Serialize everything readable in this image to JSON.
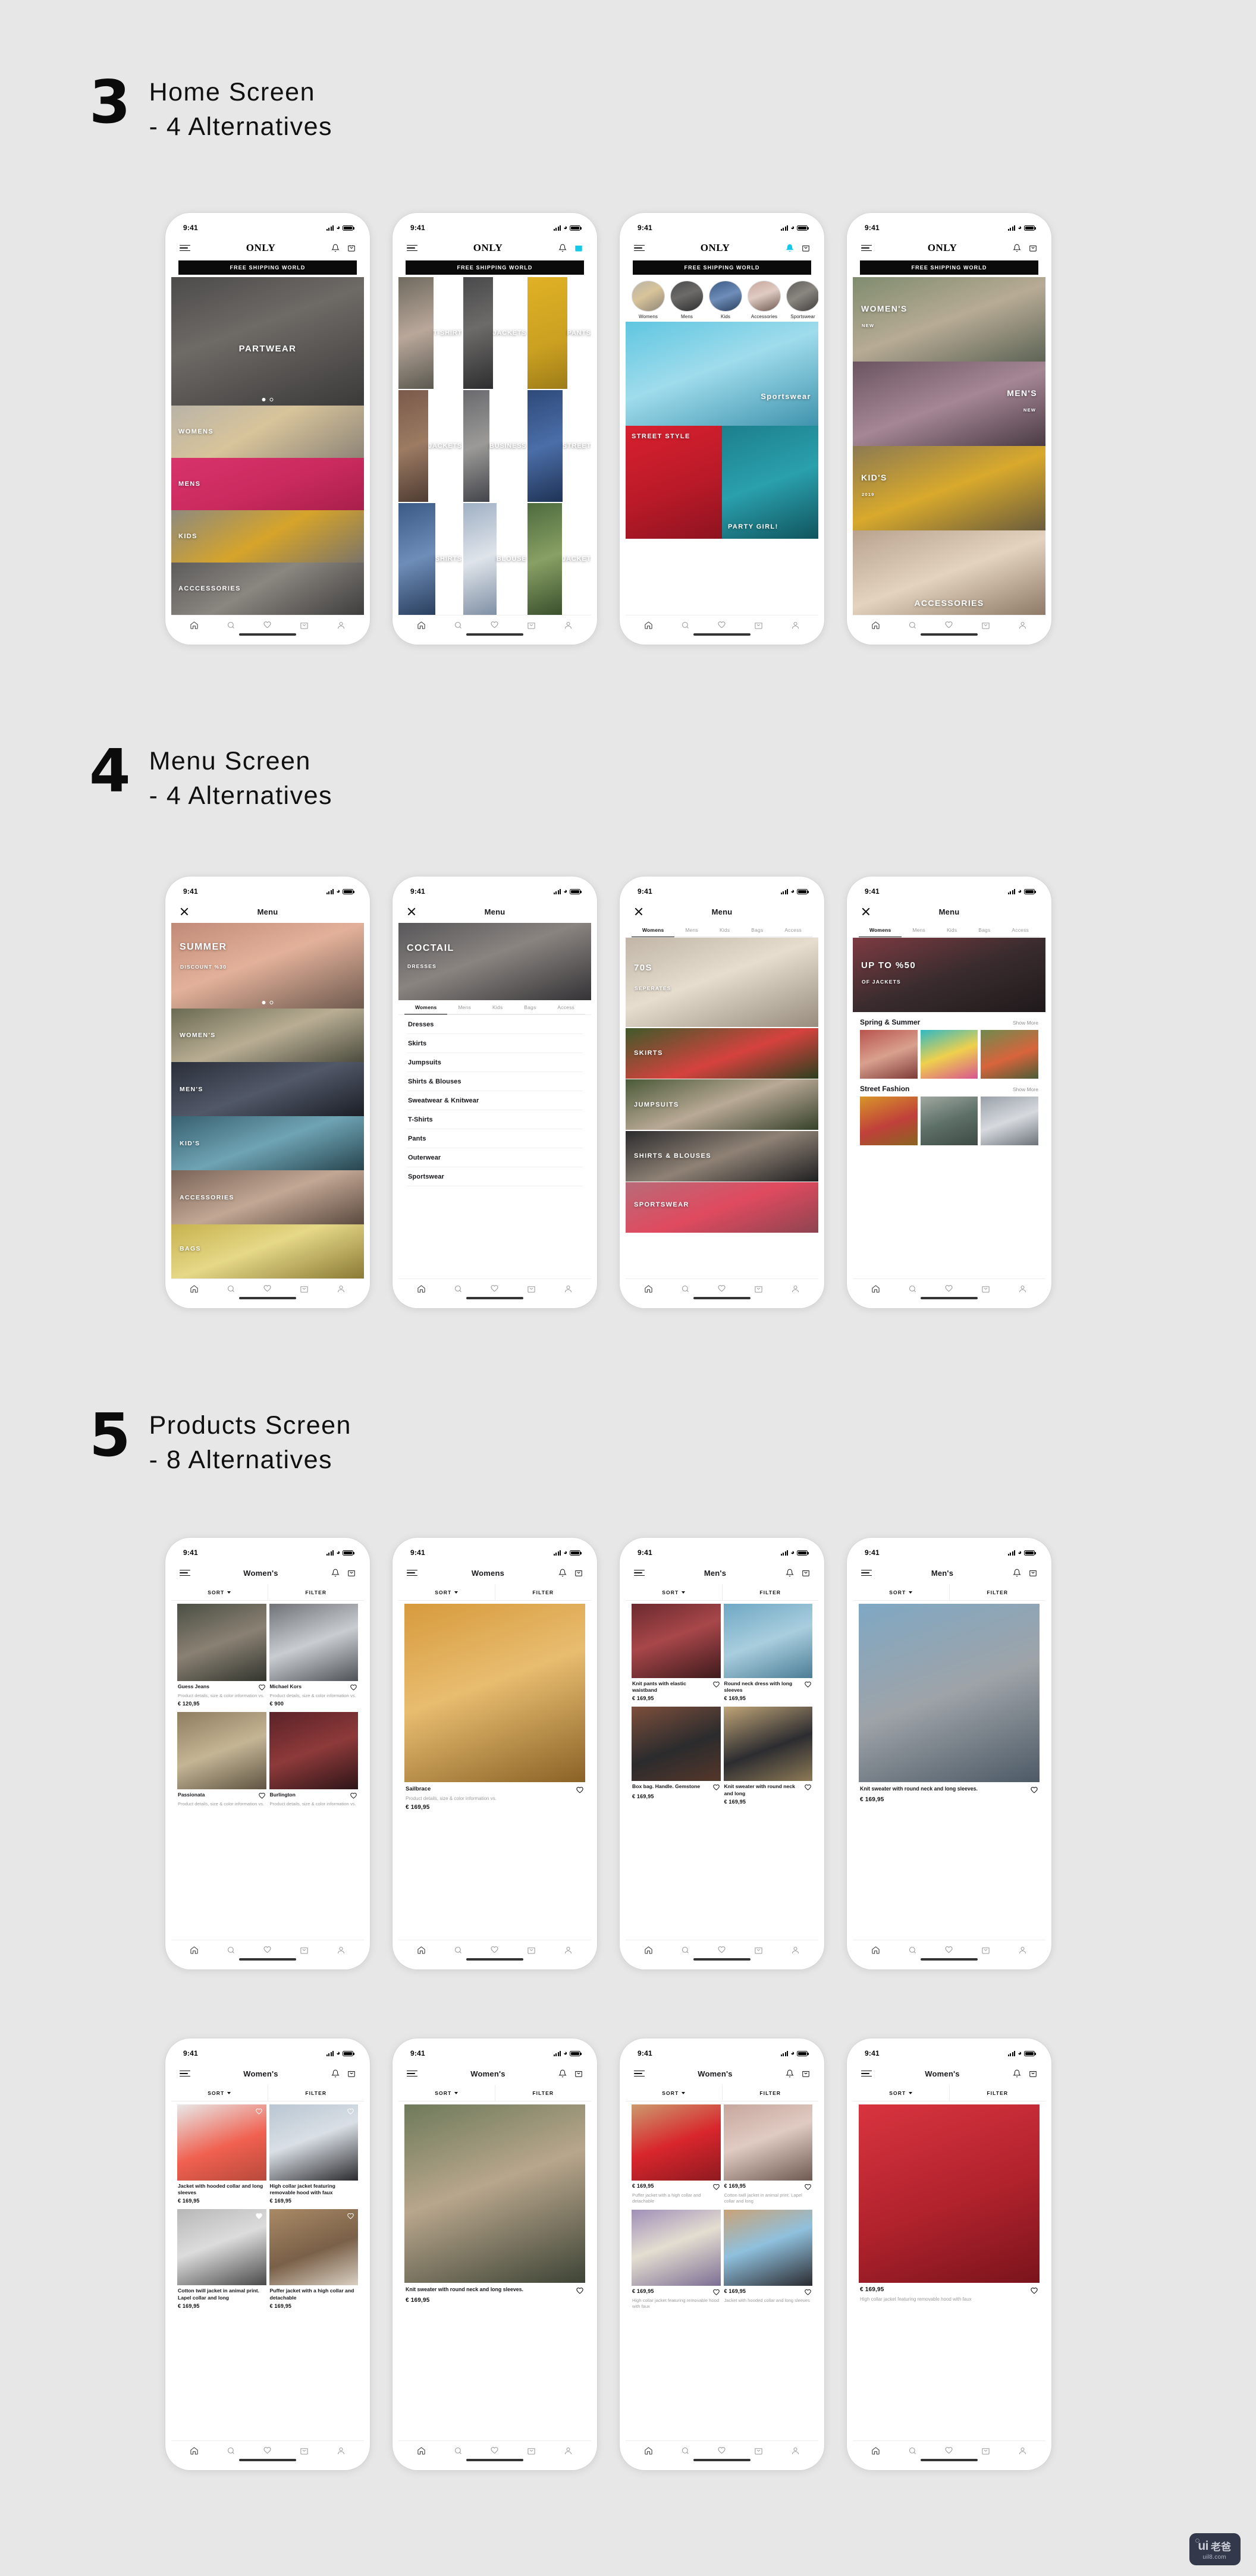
{
  "sections": [
    {
      "num": "3",
      "title_line1": "Home Screen",
      "title_line2": "- 4 Alternatives"
    },
    {
      "num": "4",
      "title_line1": "Menu Screen",
      "title_line2": "- 4 Alternatives"
    },
    {
      "num": "5",
      "title_line1": "Products Screen",
      "title_line2": "- 8 Alternatives"
    }
  ],
  "common": {
    "status_time": "9:41",
    "brand": "ONLY",
    "promo": "FREE SHIPPING WORLD",
    "menu_title": "Menu",
    "sort_label": "SORT",
    "filter_label": "FILTER",
    "show_more": "Show More",
    "tabbar_icons": [
      "home-icon",
      "search-icon",
      "heart-icon",
      "bag-icon",
      "profile-icon"
    ],
    "nav_icons": [
      "hamburger-icon",
      "bell-icon",
      "bag-icon"
    ]
  },
  "home": {
    "phone1": {
      "hero_label": "PARTWEAR",
      "categories": [
        "WOMENS",
        "MENS",
        "KIDS",
        "ACCCESSORIES"
      ]
    },
    "phone2": {
      "tiles": [
        "T-SHIRT",
        "JACKETS",
        "PANTS",
        "JACKETS",
        "BUSINESS",
        "STREET",
        "SHIRTS",
        "BLOUSE",
        "JACKET"
      ]
    },
    "phone3": {
      "stories": [
        "Womens",
        "Mens",
        "Kids",
        "Accessories",
        "Sportswear"
      ],
      "banners": [
        "Sportswear",
        "STREET STYLE",
        "PARTY GIRL!"
      ]
    },
    "phone4": {
      "blocks": [
        {
          "label": "WOMEN'S",
          "sub": "NEW"
        },
        {
          "label": "MEN'S",
          "sub": "NEW"
        },
        {
          "label": "KID'S",
          "sub": "2019"
        },
        {
          "label": "ACCESSORIES",
          "sub": ""
        }
      ]
    }
  },
  "menu": {
    "phone1": {
      "hero_title": "SUMMER",
      "hero_sub": "DISCOUNT %30",
      "items": [
        "WOMEN'S",
        "MEN'S",
        "KID'S",
        "ACCESSORIES",
        "BAGS"
      ]
    },
    "phone2": {
      "hero_title": "COCTAIL",
      "hero_sub": "DRESSES",
      "tabs": [
        "Womens",
        "Mens",
        "Kids",
        "Bags",
        "Access"
      ],
      "list": [
        "Dresses",
        "Skirts",
        "Jumpsuits",
        "Shirts & Blouses",
        "Sweatwear & Knitwear",
        "T-Shirts",
        "Pants",
        "Outerwear",
        "Sportswear"
      ]
    },
    "phone3": {
      "tabs": [
        "Womens",
        "Mens",
        "Kids",
        "Bags",
        "Access"
      ],
      "hero_title": "70S",
      "hero_sub": "SEPERATES",
      "items": [
        "SKIRTS",
        "JUMPSUITS",
        "SHIRTS & BLOUSES",
        "SPORTSWEAR"
      ]
    },
    "phone4": {
      "tabs": [
        "Womens",
        "Mens",
        "Kids",
        "Bags",
        "Access"
      ],
      "hero_title": "UP TO %50",
      "hero_sub": "OF JACKETS",
      "groups": [
        {
          "heading": "Spring & Summer",
          "action": "Show More"
        },
        {
          "heading": "Street Fashion",
          "action": "Show More"
        }
      ]
    }
  },
  "products": {
    "phone1": {
      "title": "Women's",
      "items": [
        {
          "name": "Guess Jeans",
          "desc": "Product details, size & color information vs.",
          "price": "€ 120,95"
        },
        {
          "name": "Michael Kors",
          "desc": "Product details, size & color information vs.",
          "price": "€ 900"
        },
        {
          "name": "Passionata",
          "desc": "Product details, size & color information vs.",
          "price": ""
        },
        {
          "name": "Burlington",
          "desc": "Product details, size & color information vs.",
          "price": ""
        }
      ]
    },
    "phone2": {
      "title": "Womens",
      "items": [
        {
          "name": "Sailbrace",
          "desc": "Product details, size & color information vs.",
          "price": "€ 169,95"
        }
      ]
    },
    "phone3": {
      "title": "Men's",
      "items": [
        {
          "name": "Knit pants with elastic waistband",
          "desc": "",
          "price": "€ 169,95"
        },
        {
          "name": "Round neck dress with long sleeves",
          "desc": "",
          "price": "€ 169,95"
        },
        {
          "name": "Box bag. Handle. Gemstone",
          "desc": "",
          "price": "€ 169,95"
        },
        {
          "name": "Knit sweater with round neck and long",
          "desc": "",
          "price": "€ 169,95"
        }
      ]
    },
    "phone4": {
      "title": "Men's",
      "items": [
        {
          "name": "Knit sweater with round neck and long sleeves.",
          "desc": "",
          "price": "€ 169,95"
        }
      ]
    },
    "phone5": {
      "title": "Women's",
      "items": [
        {
          "name": "Jacket with hooded collar and long sleeves",
          "desc": "",
          "price": "€ 169,95"
        },
        {
          "name": "High collar jacket featuring removable hood with faux",
          "desc": "",
          "price": "€ 169,95"
        },
        {
          "name": "Cotton twill jacket in animal print. Lapel collar and long",
          "desc": "",
          "price": "€ 169,95"
        },
        {
          "name": "Puffer jacket with a high collar and detachable",
          "desc": "",
          "price": "€ 169,95"
        }
      ]
    },
    "phone6": {
      "title": "Women's",
      "items": [
        {
          "name": "Knit sweater with round neck and long sleeves.",
          "desc": "",
          "price": "€ 169,95"
        }
      ]
    },
    "phone7": {
      "title": "Women's",
      "items": [
        {
          "price": "€ 169,95",
          "name": "Puffer jacket with a high collar and detachable"
        },
        {
          "price": "€ 169,95",
          "name": "Cotton twill jacket in animal print. Lapel collar and long"
        },
        {
          "price": "€ 169,95",
          "name": "High collar jacket featuring removable hood with faux"
        },
        {
          "price": "€ 169,95",
          "name": "Jacket with hooded collar and long sleeves"
        }
      ]
    },
    "phone8": {
      "title": "Women's",
      "items": [
        {
          "price": "€ 169,95",
          "name": "High collar jacket featuring removable hood with faux"
        }
      ]
    }
  },
  "watermark": {
    "brand": "ui",
    "brand_cn": "老爸",
    "site": "uil8.com"
  }
}
